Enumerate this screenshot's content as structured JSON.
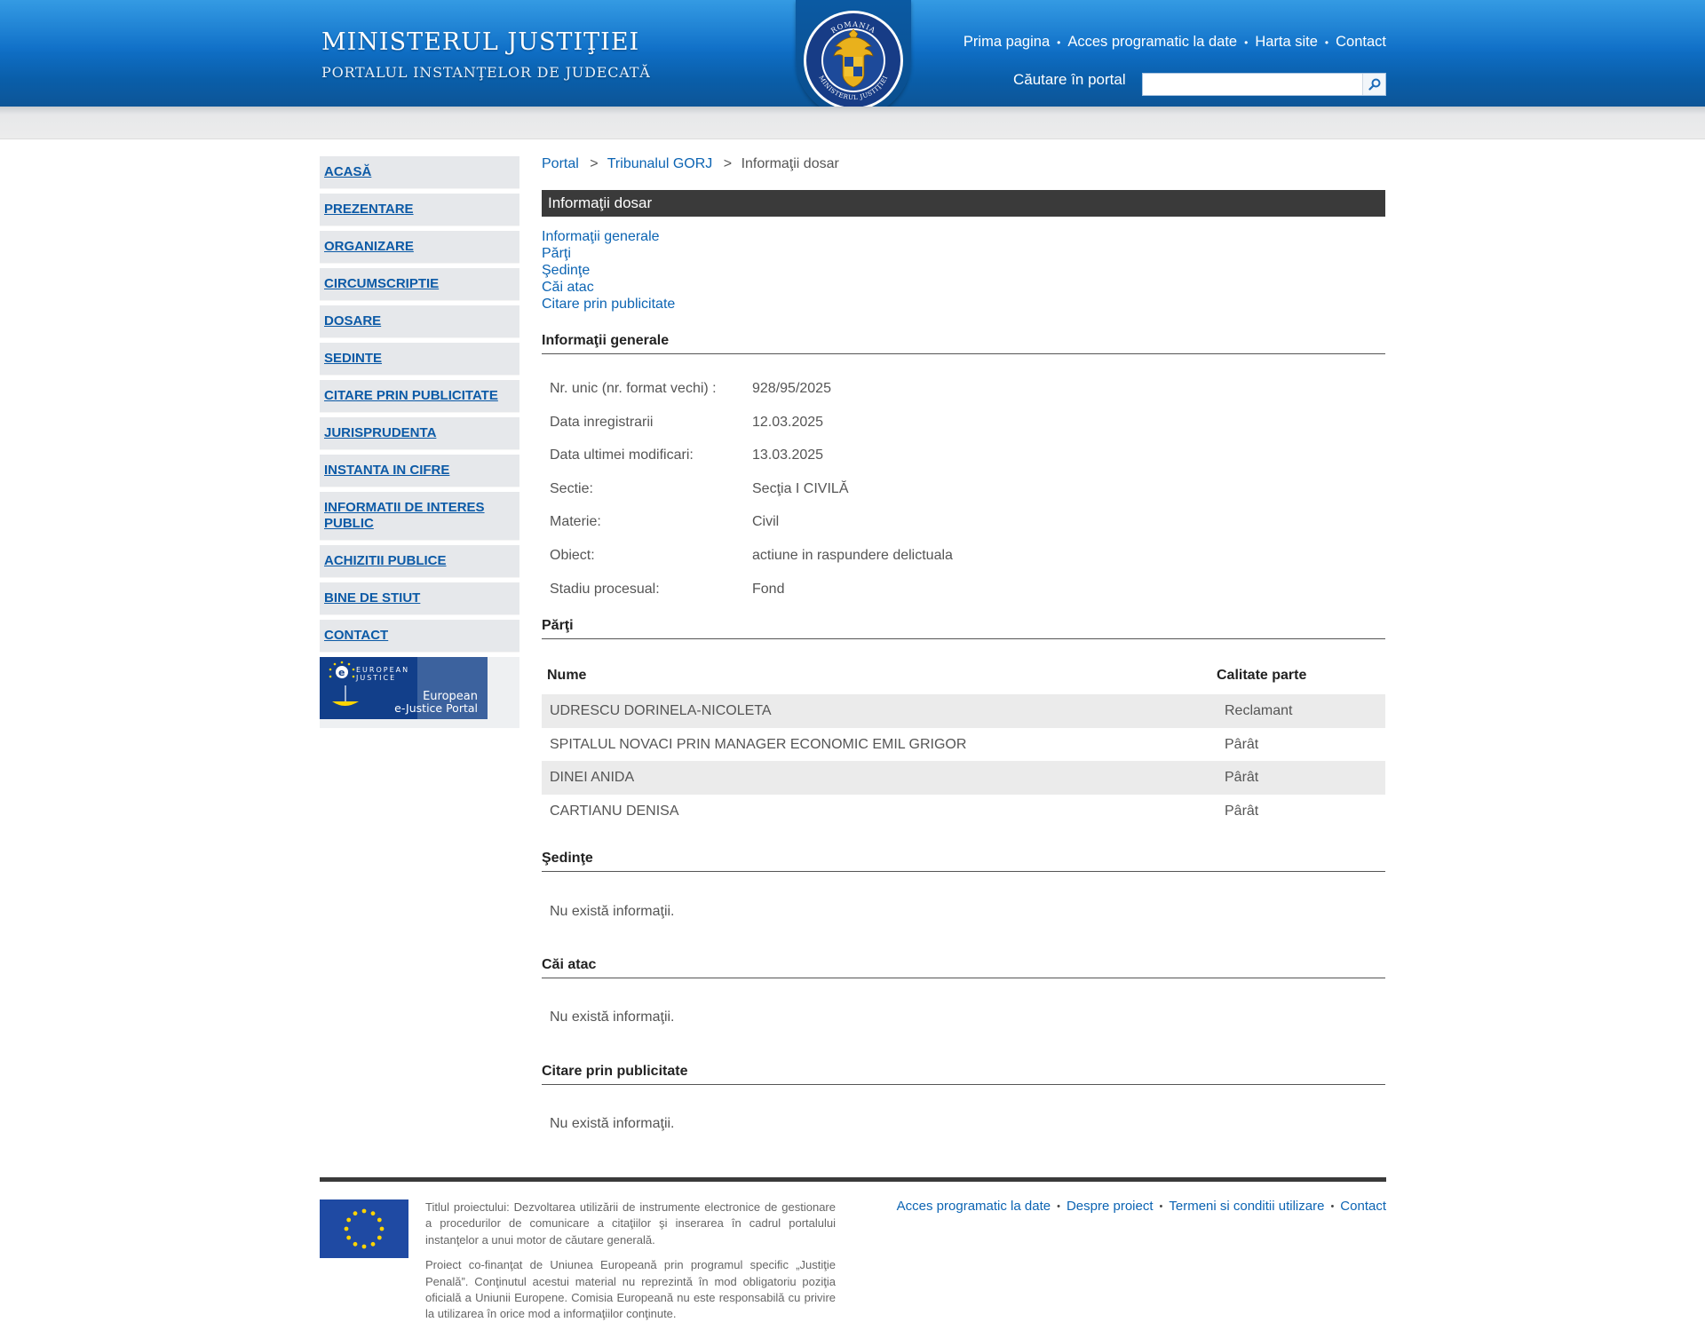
{
  "header": {
    "title": "MINISTERUL JUSTIŢIEI",
    "subtitle": "PORTALUL INSTANŢELOR DE JUDECATĂ",
    "emblem_top_text": "ROMANIA",
    "emblem_bottom_text": "MINISTERUL JUSTIŢIEI",
    "links": [
      "Prima pagina",
      "Acces programatic la date",
      "Harta site",
      "Contact"
    ],
    "search_label": "Căutare în portal",
    "search_value": "",
    "search_icon": "search-icon"
  },
  "sidebar": {
    "items": [
      "ACASĂ",
      "PREZENTARE",
      "ORGANIZARE",
      "CIRCUMSCRIPTIE",
      "DOSARE",
      "SEDINTE",
      "CITARE PRIN PUBLICITATE",
      "JURISPRUDENTA",
      "INSTANTA IN CIFRE",
      "INFORMATII DE INTERES PUBLIC",
      "ACHIZITII PUBLICE",
      "BINE DE STIUT",
      "CONTACT"
    ],
    "banner": {
      "line1": "EUROPEAN",
      "line2": "JUSTICE",
      "line3": "European",
      "line4": "e-Justice Portal"
    }
  },
  "breadcrumb": {
    "portal": "Portal",
    "court": "Tribunalul GORJ",
    "current": "Informaţii dosar",
    "sep": ">"
  },
  "page_title": "Informaţii dosar",
  "toc": [
    "Informaţii generale",
    "Părţi",
    "Şedinţe",
    "Căi atac",
    "Citare prin publicitate"
  ],
  "general": {
    "heading": "Informaţii generale",
    "rows": [
      {
        "k": "Nr. unic (nr. format vechi) :",
        "v": "928/95/2025"
      },
      {
        "k": "Data inregistrarii",
        "v": "12.03.2025"
      },
      {
        "k": "Data ultimei modificari:",
        "v": "13.03.2025"
      },
      {
        "k": "Sectie:",
        "v": "Secţia I CIVILĂ"
      },
      {
        "k": "Materie:",
        "v": "Civil"
      },
      {
        "k": "Obiect:",
        "v": "actiune in raspundere delictuala"
      },
      {
        "k": "Stadiu procesual:",
        "v": "Fond"
      }
    ]
  },
  "parti": {
    "heading": "Părţi",
    "col_name": "Nume",
    "col_role": "Calitate parte",
    "rows": [
      {
        "n": "UDRESCU DORINELA-NICOLETA",
        "c": "Reclamant"
      },
      {
        "n": "SPITALUL NOVACI PRIN MANAGER ECONOMIC EMIL GRIGOR",
        "c": "Pârât"
      },
      {
        "n": "DINEI ANIDA",
        "c": "Pârât"
      },
      {
        "n": "CARTIANU DENISA",
        "c": "Pârât"
      }
    ]
  },
  "sedinte": {
    "heading": "Şedinţe",
    "empty": "Nu există informaţii."
  },
  "cai_atac": {
    "heading": "Căi atac",
    "empty": "Nu există informaţii."
  },
  "citare": {
    "heading": "Citare prin publicitate",
    "empty": "Nu există informaţii."
  },
  "footer": {
    "text1": "Titlul proiectului: Dezvoltarea utilizării de instrumente electronice de gestionare a procedurilor de comunicare a citaţiilor şi inserarea în cadrul portalului instanţelor a unui motor de căutare generală.",
    "text2": "Proiect co-finanţat de Uniunea Europeană prin programul specific „Justiţie Penală”. Conţinutul acestui material nu reprezintă în mod obligatoriu poziţia oficială a Uniunii Europene. Comisia Europeană nu este responsabilă cu privire la utilizarea în orice mod a informaţiilor conţinute.",
    "links": [
      "Acces programatic la date",
      "Despre proiect",
      "Termeni si conditii utilizare",
      "Contact"
    ]
  },
  "colors": {
    "header_blue": "#0f70c8",
    "link_blue": "#0c64b3",
    "title_bar": "#3a3a3a",
    "eu_blue": "#1f4aa3",
    "eu_gold": "#ffd400"
  }
}
